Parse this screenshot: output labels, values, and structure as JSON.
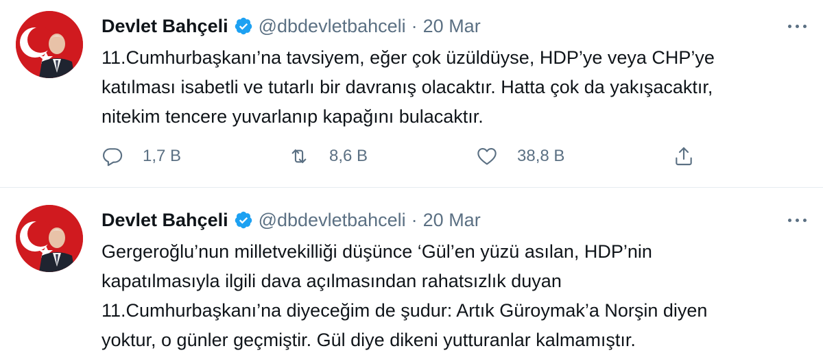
{
  "tweets": [
    {
      "author_name": "Devlet Bahçeli",
      "handle": "@dbdevletbahceli",
      "separator": "·",
      "date": "20 Mar",
      "text": "11.Cumhurbaşkanı’na tavsiyem, eğer çok üzüldüyse, HDP’ye veya CHP’ye\nkatılması isabetli ve tutarlı bir davranış olacaktır. Hatta çok da yakışacaktır,\nnitekim tencere yuvarlanıp kapağını bulacaktır.",
      "reply_count": "1,7 B",
      "retweet_count": "8,6 B",
      "like_count": "38,8 B"
    },
    {
      "author_name": "Devlet Bahçeli",
      "handle": "@dbdevletbahceli",
      "separator": "·",
      "date": "20 Mar",
      "text": "Gergeroğlu’nun milletvekilliği düşünce ‘Gül’en yüzü asılan, HDP’nin\nkapatılmasıyla ilgili dava açılmasından rahatsızlık duyan\n11.Cumhurbaşkanı’na diyeceğim de şudur: Artık Güroymak’a Norşin diyen\nyoktur, o günler geçmiştir. Gül diye dikeni yutturanlar kalmamıştır."
    }
  ],
  "icons": {
    "verified": "verified-badge-icon",
    "more": "more-options-icon",
    "reply": "reply-icon",
    "retweet": "retweet-icon",
    "like": "like-heart-icon",
    "share": "share-icon"
  },
  "colors": {
    "text": "#0f1419",
    "secondary": "#5b7083",
    "verified": "#1da1f2",
    "avatar_background": "#d01a1f",
    "divider": "#e6ecf0"
  }
}
